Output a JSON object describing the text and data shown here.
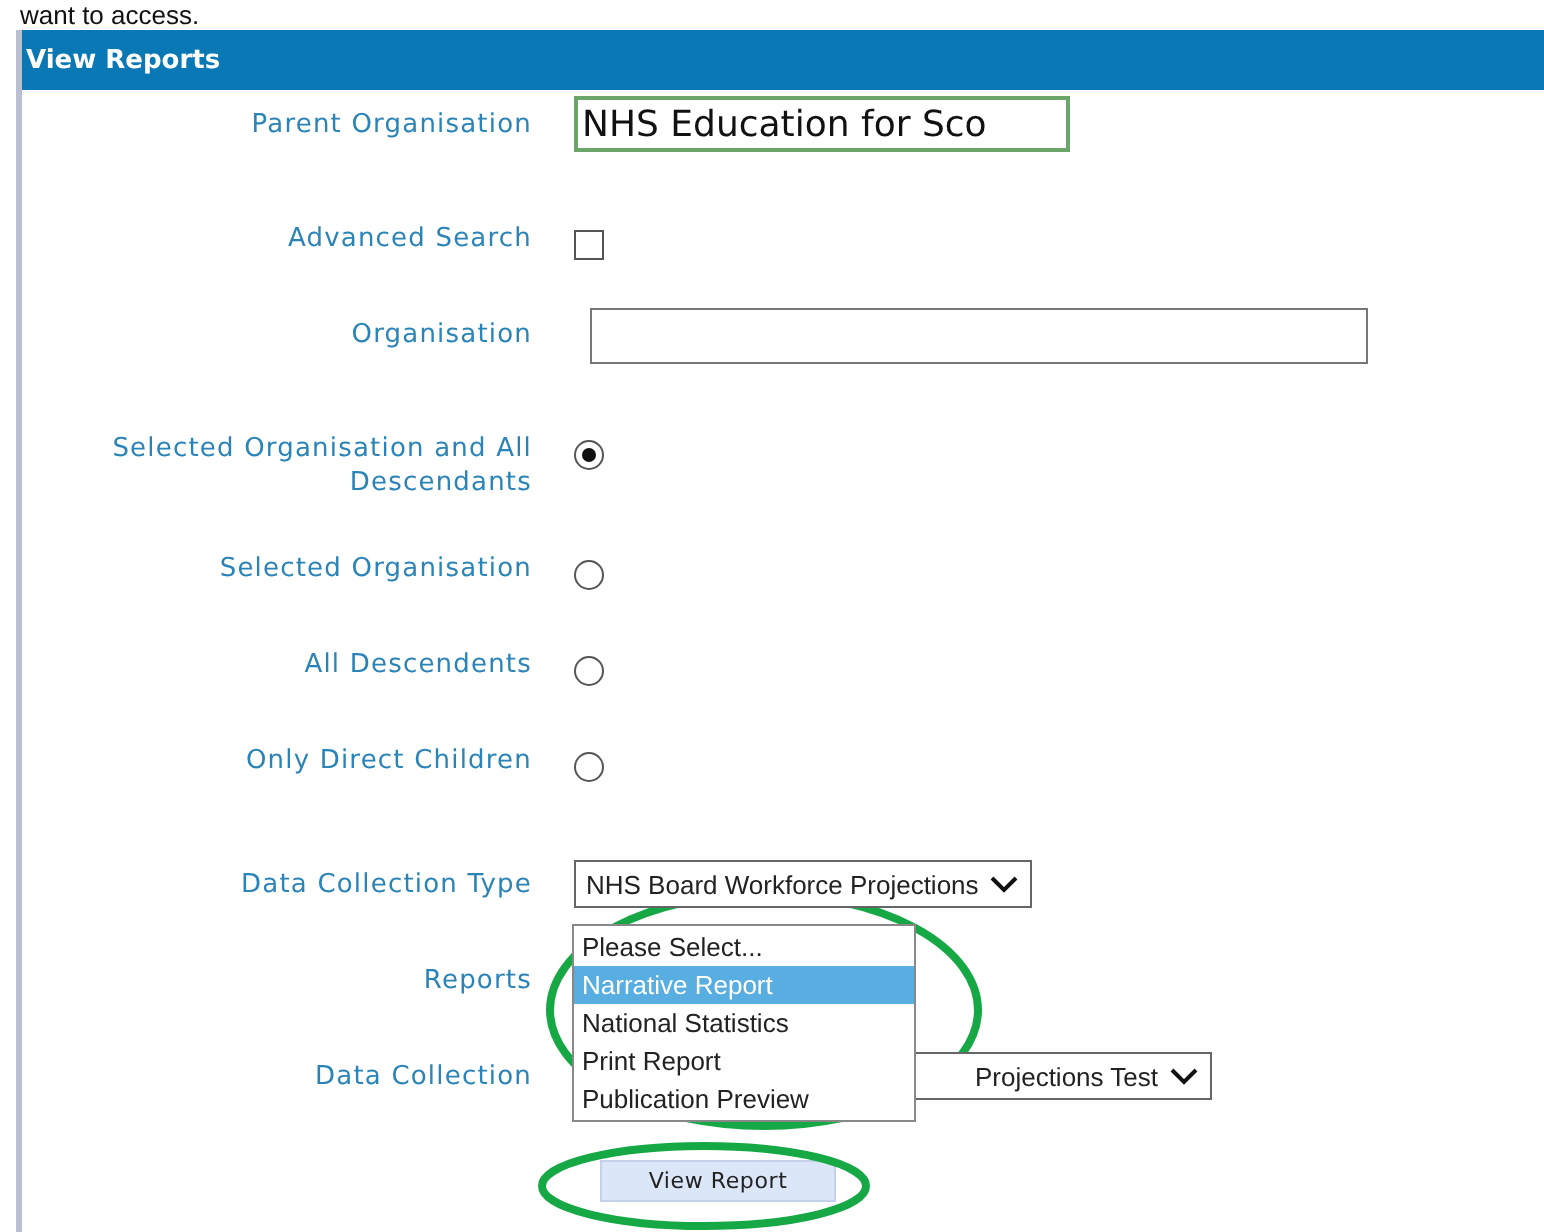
{
  "intro_text": "want to access.",
  "panel": {
    "title": "View Reports"
  },
  "fields": [
    {
      "kind": "text",
      "label": "Parent Organisation",
      "value": "NHS Education for Sco",
      "focused": true
    },
    {
      "kind": "checkbox",
      "label": "Advanced Search",
      "checked": false
    },
    {
      "kind": "text",
      "label": "Organisation",
      "focused": false
    },
    {
      "kind": "radio",
      "label": "Selected Organisation and All Descendants",
      "selected": true
    },
    {
      "kind": "radio",
      "label": "Selected Organisation",
      "selected": false
    },
    {
      "kind": "radio",
      "label": "All Descendents",
      "selected": false
    },
    {
      "kind": "radio",
      "label": "Only Direct Children",
      "selected": false
    },
    {
      "kind": "select",
      "label": "Data Collection Type",
      "value": "NHS Board Workforce Projections"
    },
    {
      "kind": "listbox",
      "label": "Reports",
      "highlighted": true,
      "options": [
        {
          "label": "Please Select...",
          "selected": false
        },
        {
          "label": "Narrative Report",
          "selected": true
        },
        {
          "label": "National Statistics",
          "selected": false
        },
        {
          "label": "Print Report",
          "selected": false
        },
        {
          "label": "Publication Preview",
          "selected": false
        }
      ]
    },
    {
      "kind": "select",
      "label": "Data Collection",
      "value": "Projections Test",
      "covered": true
    }
  ],
  "button": {
    "label": "View Report",
    "highlighted": true
  }
}
